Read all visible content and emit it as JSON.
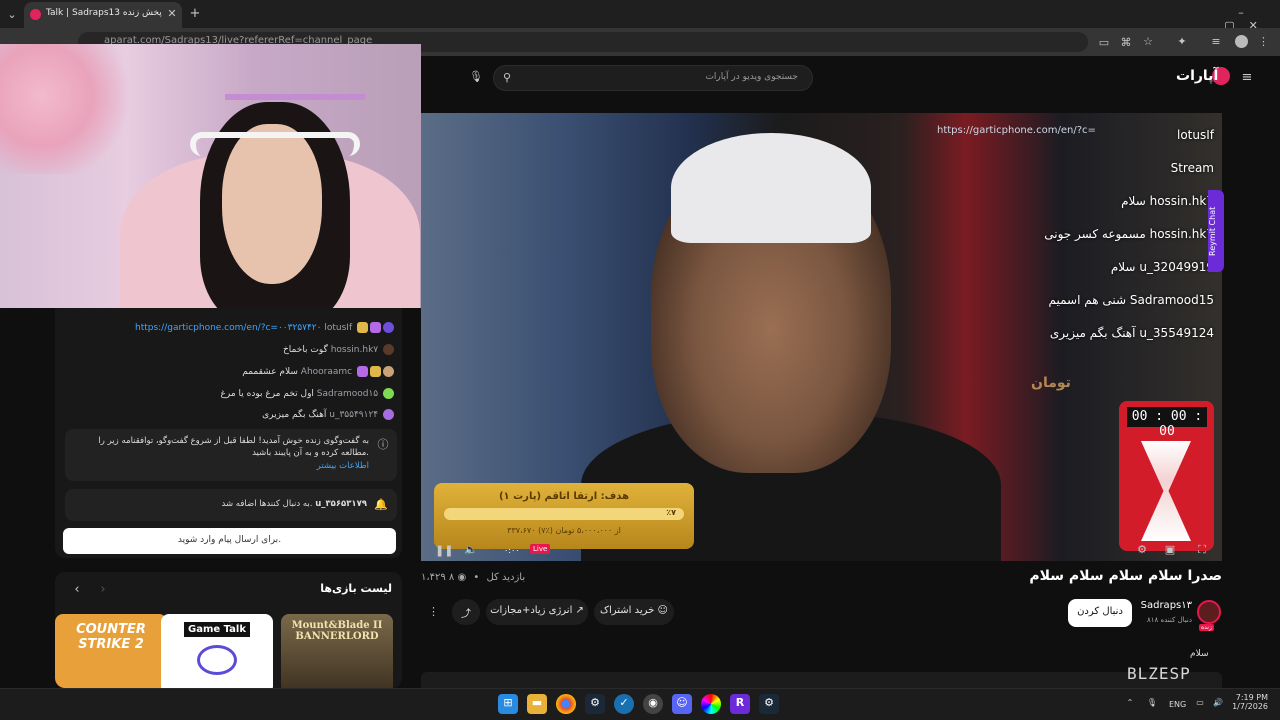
{
  "browser": {
    "tab_title": "Talk | Sadraps13 پخش زنده",
    "url": "aparat.com/Sadraps13/live?refererRef=channel_page"
  },
  "header": {
    "logo": "آپارات",
    "search_placeholder": "جستجوی ویدیو در آپارات"
  },
  "player": {
    "live_label": "Live",
    "time": "۰:۰۰",
    "timer": "00 : 00 : 00",
    "goal_title": "هدف: ارتقا اتاقم (پارت ۱)",
    "goal_sub": "۳۳۷،۶۷۰ از ۵،۰۰۰،۰۰۰ تومان (٪۷)",
    "goal_pct": "٪۷",
    "overlay_url": "https://garticphone.com/en/?c=",
    "overlay_chat": [
      {
        "user": "lotusIf",
        "text": ""
      },
      {
        "user": "Stream",
        "text": ""
      },
      {
        "user": "hossin.hk7",
        "text": "سلام"
      },
      {
        "user": "hossin.hk7",
        "text": "مسموعه کسر جونی"
      },
      {
        "user": "u_32049919",
        "text": "سلام"
      },
      {
        "user": "Sadramood15",
        "text": "شنی هم اسمیم"
      },
      {
        "user": "u_35549124",
        "text": "آهنگ بگم میزیری"
      }
    ],
    "overlay_donation": "تومان",
    "reymit_label": "Reymit Chat"
  },
  "video": {
    "title": "صدرا سلام سلام سلام سلام",
    "views": "۱،۴۲۹ بازدید کل",
    "watching": "۸",
    "buy_sub": "خرید اشتراک",
    "energy": "انرژی زیاد+مجازات",
    "follow": "دنبال کردن",
    "channel": "Sadraps۱۳",
    "followers": "۸۱۸ دنبال کننده",
    "live_tag": "زنده",
    "description": "سلام"
  },
  "chat": {
    "messages": [
      {
        "user": "lotusIf",
        "text": "https://garticphone.com/en/?c=۰۰۳۲۵۷۴۲۰"
      },
      {
        "user": "hossin.hk۷",
        "text": "گوت باخماخ"
      },
      {
        "user": "Ahooraamc",
        "text": "سلام عشقممم"
      },
      {
        "user": "Sadramood۱۵",
        "text": "اول تخم مرغ بوده یا مرغ"
      },
      {
        "user": "u_۳۵۵۴۹۱۲۴",
        "text": "آهنگ بگم میزیری"
      }
    ],
    "notice": "به گفت‌وگوی زنده خوش آمدید! لطفا قبل از شروع گفت‌وگو، توافقنامه زیر را مطالعه کرده و به آن پایبند باشید.",
    "notice_link": "اطلاعات بیشتر",
    "follow_user": "u_۳۵۶۵۳۱۷۹",
    "follow_text": "به دنبال کنندها اضافه شد.",
    "input_placeholder": "برای ارسال پیام وارد شوید."
  },
  "games": {
    "title": "لیست بازی‌ها",
    "items": [
      {
        "name": "COUNTER STRIKE 2"
      },
      {
        "name": "Game Talk"
      },
      {
        "name": "Mount&Blade II BANNERLORD"
      }
    ]
  },
  "taskbar": {
    "lang": "ENG",
    "time": "7:19 PM",
    "date": "1/7/2026"
  },
  "watermark": "BLZESP"
}
